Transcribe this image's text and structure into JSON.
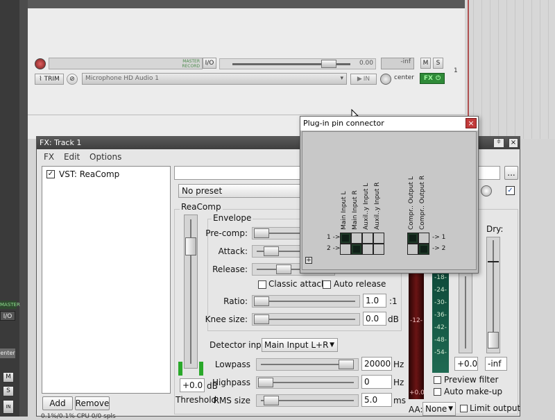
{
  "tcp": {
    "master_tag": "MASTER\nRECORD",
    "io_label": "I/O",
    "volume_value": "0.00",
    "peak_value": "-inf",
    "mute_label": "M",
    "solo_label": "S",
    "trim_label": "TRIM",
    "input_device": "Microphone HD Audio 1",
    "in_label": "IN",
    "pan_label": "center",
    "fx_label": "FX",
    "track_number": "1"
  },
  "left_strip": {
    "master_label": "MASTER",
    "io_label": "I/O",
    "center_label": "enter",
    "mute_label": "M",
    "solo_label": "S",
    "in_label": "IN"
  },
  "fx_window": {
    "title": "FX: Track 1",
    "menu": [
      "FX",
      "Edit",
      "Options"
    ],
    "plugins": [
      {
        "name": "VST: ReaComp",
        "enabled": true
      }
    ],
    "add_label": "Add",
    "remove_label": "Remove",
    "status": "0.1%/0.1% CPU 0/0 spls",
    "preset": "No preset",
    "more_label": "...",
    "comp": {
      "group_title": "ReaComp",
      "threshold_value": "+0.0",
      "threshold_unit": "dB",
      "threshold_label": "Threshold",
      "envelope_title": "Envelope",
      "precomp_label": "Pre-comp:",
      "attack_label": "Attack:",
      "release_label": "Release:",
      "classic_attack": "Classic attack",
      "auto_release": "Auto release",
      "ratio_label": "Ratio:",
      "ratio_value": "1.0",
      "ratio_unit": ":1",
      "knee_label": "Knee size:",
      "knee_value": "0.0",
      "knee_unit": "dB",
      "detector_label": "Detector input:",
      "detector_value": "Main Input L+R",
      "lowpass_label": "Lowpass",
      "lowpass_value": "20000",
      "highpass_label": "Highpass",
      "highpass_value": "0",
      "hz_unit": "Hz",
      "rms_label": "RMS size",
      "rms_value": "5.0",
      "ms_unit": "ms",
      "meter_value": "+0.0",
      "meter_scale_left": "-12-",
      "gr_scale": [
        "-18-",
        "-24-",
        "-30-",
        "-36-",
        "-42-",
        "-48-",
        "-54-"
      ],
      "wet_value": "+0.0",
      "dry_label": "Dry:",
      "dry_value": "-inf",
      "preview_filter": "Preview filter",
      "auto_makeup": "Auto make-up",
      "aa_label": "AA:",
      "aa_value": "None",
      "limit_output": "Limit output"
    }
  },
  "pin_connector": {
    "title": "Plug-in pin connector",
    "close_label": "×",
    "inputs": [
      "Main Input L",
      "Main Input R",
      "Auxil..y Input L",
      "Auxil..y Input R"
    ],
    "outputs": [
      "Compr.. Output L",
      "Compr.. Output R"
    ],
    "row_labels": [
      "1 ->",
      "2 ->"
    ],
    "out_row_labels": [
      "-> 1",
      "-> 2"
    ],
    "input_matrix": [
      [
        true,
        false,
        false,
        false
      ],
      [
        false,
        true,
        false,
        false
      ]
    ],
    "output_matrix": [
      [
        true,
        false
      ],
      [
        false,
        true
      ]
    ],
    "expand_label": "+"
  }
}
